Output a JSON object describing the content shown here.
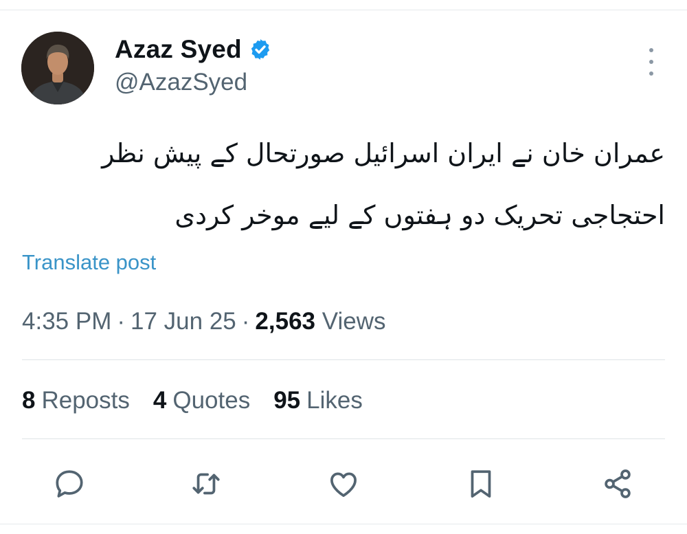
{
  "author": {
    "display_name": "Azaz Syed",
    "handle": "@AzazSyed",
    "verified": true,
    "avatar_icon": "profile-photo"
  },
  "post": {
    "lines": [
      "عمران خان نے ایران اسرائیل صورتحال کے پیش نظر",
      "احتجاجی تحریک دو ہفتوں کے لیے موخر کردی"
    ],
    "translate_label": "Translate post"
  },
  "meta": {
    "time": "4:35 PM",
    "separator": "·",
    "date": "17 Jun 25",
    "views_count": "2,563",
    "views_label": "Views"
  },
  "stats": {
    "reposts_count": "8",
    "reposts_label": "Reposts",
    "quotes_count": "4",
    "quotes_label": "Quotes",
    "likes_count": "95",
    "likes_label": "Likes"
  },
  "actions": [
    "reply-icon",
    "repost-icon",
    "like-icon",
    "bookmark-icon",
    "share-icon"
  ],
  "colors": {
    "text": "#0f1419",
    "secondary": "#536471",
    "link": "#3a94c8",
    "verified": "#1d9bf0",
    "icon": "#536471"
  }
}
